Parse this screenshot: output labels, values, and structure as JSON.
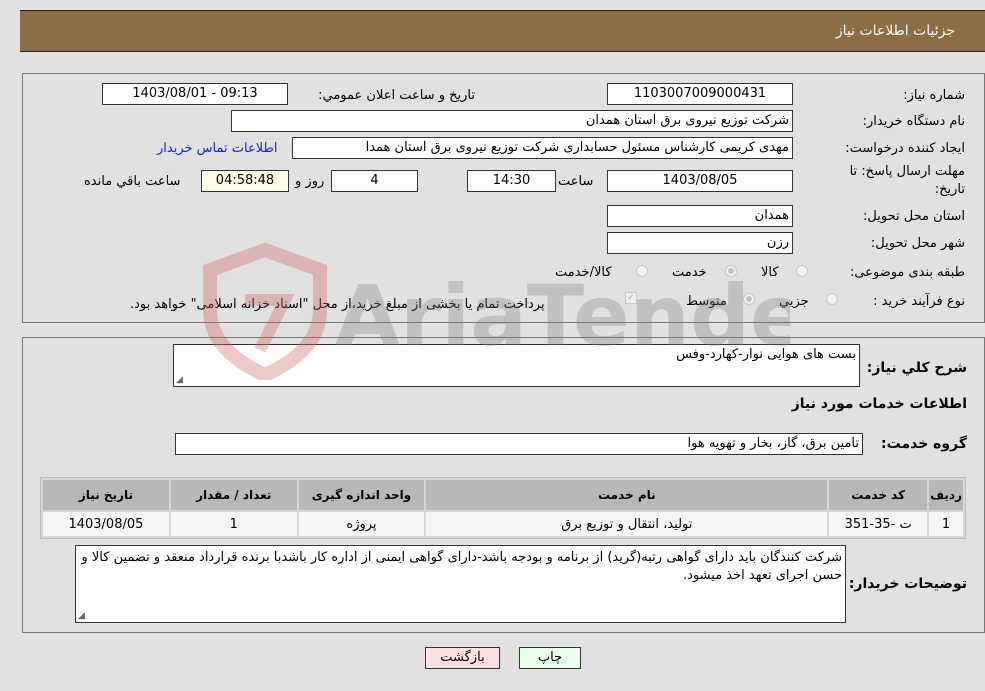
{
  "header": {
    "title": "جزئیات اطلاعات نیاز"
  },
  "form": {
    "need_number": {
      "label": "شماره نیاز:",
      "value": "1103007009000431"
    },
    "announce_datetime": {
      "label": "تاریخ و ساعت اعلان عمومي:",
      "value": "1403/08/01 - 09:13"
    },
    "buyer_org": {
      "label": "نام دستگاه خریدار:",
      "value": "شرکت توزیع نیروی برق استان همدان"
    },
    "requester": {
      "label": "ایجاد کننده درخواست:",
      "value": "مهدی کریمی کارشناس مسئول حسابداری شرکت توزیع نیروی برق استان همدا"
    },
    "buyer_contact_link": "اطلاعات تماس خریدار",
    "deadline": {
      "label_line1": "مهلت ارسال پاسخ: تا",
      "label_line2": "تاریخ:",
      "date": "1403/08/05",
      "time_label": "ساعت",
      "time": "14:30",
      "days": "4",
      "days_label": "روز و",
      "remaining": "04:58:48",
      "remaining_label": "ساعت باقي مانده"
    },
    "delivery_province": {
      "label": "استان محل تحویل:",
      "value": "همدان"
    },
    "delivery_city": {
      "label": "شهر محل تحویل:",
      "value": "رزن"
    },
    "category": {
      "label": "طبقه بندی موضوعی:",
      "options": [
        {
          "label": "کالا",
          "checked": false
        },
        {
          "label": "خدمت",
          "checked": true
        },
        {
          "label": "کالا/خدمت",
          "checked": false
        }
      ]
    },
    "purchase_type": {
      "label": "نوع فرآیند خرید :",
      "options": [
        {
          "label": "جزيي",
          "checked": false
        },
        {
          "label": "متوسط",
          "checked": true
        }
      ],
      "treasury_note": "پرداخت تمام یا بخشی از مبلغ خرید،از محل \"اسناد خزانه اسلامی\" خواهد بود.",
      "treasury_checked": true
    }
  },
  "details": {
    "summary_label": "شرح کلي نیاز:",
    "summary_value": "بست های هوایی نوار-کهارد-وفس",
    "services_heading": "اطلاعات خدمات مورد نیاز",
    "service_group_label": "گروه خدمت:",
    "service_group_value": "تامین برق، گاز، بخار و تهویه هوا",
    "table": {
      "headers": [
        "ردیف",
        "کد خدمت",
        "نام خدمت",
        "واحد اندازه گیری",
        "تعداد / مقدار",
        "تاریخ نیاز"
      ],
      "rows": [
        [
          "1",
          "ت -35-351",
          "تولید، انتقال و توزیع برق",
          "پروژه",
          "1",
          "1403/08/05"
        ]
      ]
    },
    "buyer_notes_label": "توضیحات خریدار:",
    "buyer_notes_value": "شرکت کنندگان باید دارای گواهی رتبه(گرید) از برنامه و بودجه باشد-دارای گواهی ایمنی از اداره کار باشدبا برنده قرارداد منعقد و تضمین کالا و حسن اجرای تعهد اخذ میشود."
  },
  "buttons": {
    "print": "چاپ",
    "back": "بازگشت"
  },
  "colors": {
    "header_bg": "#8d6b43",
    "link": "#1a22d8",
    "print_bg": "#eaffea",
    "back_bg": "#ffe0e0"
  },
  "watermark": {
    "text": "AriaTender.neT"
  }
}
